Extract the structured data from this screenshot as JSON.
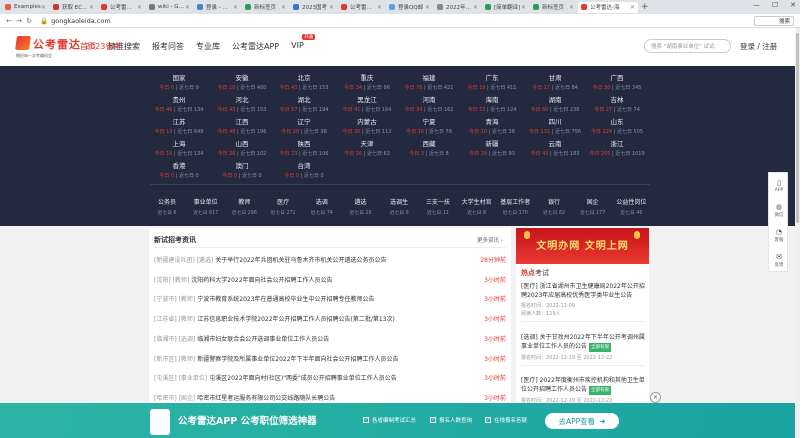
{
  "tabs": [
    {
      "label": "Examples",
      "color": "#e35b4f"
    },
    {
      "label": "获取 EChar",
      "color": "#cc3333"
    },
    {
      "label": "公考雷达-海",
      "color": "#e23a30"
    },
    {
      "label": "wiki - Goo",
      "color": "#777777"
    },
    {
      "label": "登录 - 素材",
      "color": "#3a87c8"
    },
    {
      "label": "新标签页",
      "color": "#2d9a5c"
    },
    {
      "label": "2023国考",
      "color": "#2d78d6"
    },
    {
      "label": "公考雷达-海",
      "color": "#e23a30"
    },
    {
      "label": "登录QQ邮",
      "color": "#5aa0e6"
    },
    {
      "label": "2022年事业",
      "color": "#888888"
    },
    {
      "label": "[简单翻译]",
      "color": "#2d9a5c"
    },
    {
      "label": "新标签页",
      "color": "#2d9a5c"
    },
    {
      "label": "公考雷达-海",
      "color": "#e23a30",
      "active": true
    }
  ],
  "window_controls": [
    "—",
    "☐",
    "✕"
  ],
  "address": {
    "url": "gongkaoleida.com",
    "search": "搜索"
  },
  "header": {
    "logo_name": "公考雷达",
    "logo_slogan": "捕捉每一次考编机会",
    "nav": [
      {
        "label": "首页",
        "state": "cur"
      },
      {
        "label": "精准搜索"
      },
      {
        "label": "报考问答"
      },
      {
        "label": "2023省考",
        "state": "hot"
      },
      {
        "label": "专业库"
      },
      {
        "label": "公考雷达APP"
      },
      {
        "label": "VIP",
        "badge": "开通"
      }
    ],
    "search_placeholder": "搜索 \"湖南事业单位\" 试试",
    "login": "登录 / 注册"
  },
  "provinces": [
    {
      "name": "国家",
      "today": "今日 0",
      "week": "近七日 9"
    },
    {
      "name": "安徽",
      "today": "今日 10",
      "week": "近七日 460"
    },
    {
      "name": "北京",
      "today": "今日 43",
      "week": "近七日 153"
    },
    {
      "name": "重庆",
      "today": "今日 34",
      "week": "近七日 96"
    },
    {
      "name": "福建",
      "today": "今日 76",
      "week": "近七日 421"
    },
    {
      "name": "广东",
      "today": "今日 19",
      "week": "近七日 411"
    },
    {
      "name": "甘肃",
      "today": "今日 17",
      "week": "近七日 84"
    },
    {
      "name": "广西",
      "today": "今日 50",
      "week": "近七日 345"
    },
    {
      "name": "贵州",
      "today": "今日 46",
      "week": "近七日 134"
    },
    {
      "name": "河北",
      "today": "今日 43",
      "week": "近七日 153"
    },
    {
      "name": "湖北",
      "today": "今日 57",
      "week": "近七日 194"
    },
    {
      "name": "黑龙江",
      "today": "今日 41",
      "week": "近七日 164"
    },
    {
      "name": "河南",
      "today": "今日 34",
      "week": "近七日 162"
    },
    {
      "name": "海南",
      "today": "今日 23",
      "week": "近七日 124"
    },
    {
      "name": "湖南",
      "today": "今日 60",
      "week": "近七日 238"
    },
    {
      "name": "吉林",
      "today": "今日 27",
      "week": "近七日 74"
    },
    {
      "name": "江苏",
      "today": "今日 13",
      "week": "近七日 649"
    },
    {
      "name": "江西",
      "today": "今日 48",
      "week": "近七日 196"
    },
    {
      "name": "辽宁",
      "today": "今日 20",
      "week": "近七日 98"
    },
    {
      "name": "内蒙古",
      "today": "今日 35",
      "week": "近七日 112"
    },
    {
      "name": "宁夏",
      "today": "今日 16",
      "week": "近七日 78"
    },
    {
      "name": "青海",
      "today": "今日 10",
      "week": "近七日 38"
    },
    {
      "name": "四川",
      "today": "今日 131",
      "week": "近七日 756"
    },
    {
      "name": "山东",
      "today": "今日 124",
      "week": "近七日 505"
    },
    {
      "name": "上海",
      "today": "今日 16",
      "week": "近七日 134"
    },
    {
      "name": "山西",
      "today": "今日 26",
      "week": "近七日 102"
    },
    {
      "name": "陕西",
      "today": "今日 23",
      "week": "近七日 106"
    },
    {
      "name": "天津",
      "today": "今日 16",
      "week": "近七日 63"
    },
    {
      "name": "西藏",
      "today": "今日 3",
      "week": "近七日 8"
    },
    {
      "name": "新疆",
      "today": "今日 29",
      "week": "近七日 93"
    },
    {
      "name": "云南",
      "today": "今日 43",
      "week": "近七日 183"
    },
    {
      "name": "浙江",
      "today": "今日 205",
      "week": "近七日 1019"
    },
    {
      "name": "香港",
      "today": "今日 0",
      "week": "近七日 0"
    },
    {
      "name": "澳门",
      "today": "今日 0",
      "week": "近七日 0"
    },
    {
      "name": "台湾",
      "today": "今日 0",
      "week": "近七日 0"
    }
  ],
  "categories": [
    {
      "name": "公务员",
      "count": "近七日 6"
    },
    {
      "name": "事业单位",
      "count": "近七日 617"
    },
    {
      "name": "教师",
      "count": "近七日 296"
    },
    {
      "name": "医疗",
      "count": "近七日 272"
    },
    {
      "name": "选调",
      "count": "近七日 74"
    },
    {
      "name": "遴选",
      "count": "近七日 26"
    },
    {
      "name": "选调生",
      "count": "近七日 9"
    },
    {
      "name": "三支一扶",
      "count": "近七日 11"
    },
    {
      "name": "大学生村官",
      "count": "近七日 8"
    },
    {
      "name": "基层工作者",
      "count": "近七日 170"
    },
    {
      "name": "银行",
      "count": "近七日 82"
    },
    {
      "name": "国企",
      "count": "近七日 177"
    },
    {
      "name": "公益性岗位",
      "count": "近七日 46"
    }
  ],
  "news": {
    "title": "新试招考资讯",
    "more": "更多资讯 ›",
    "items": [
      {
        "tag": "[新疆建设兵团] [遴选]",
        "title": "关于举行2022年兵团机关驻乌鲁木齐市机关公开遴选公务员公告",
        "time": "28分钟前"
      },
      {
        "tag": "[沈阳] [教师]",
        "title": "沈阳药科大学2022年面向社会公开招聘工作人员公告",
        "time": "3小时前"
      },
      {
        "tag": "[宁波市] [教师]",
        "title": "宁波市教育系统2023年在普通高校毕业生中公开招聘专任教师公告",
        "time": "3小时前"
      },
      {
        "tag": "[江苏省] [教师]",
        "title": "江苏信息职业技术学院2022年公开招聘工作人员招聘公告(第二批/第13次)",
        "time": "3小时前"
      },
      {
        "tag": "[临湘市] [选调]",
        "title": "临湘市妇女联合会公开选调事业单位工作人员公告",
        "time": "3小时前"
      },
      {
        "tag": "[新市区] [教师]",
        "title": "新疆警察学院及所属事业单位2022年下半年面向社会公开招聘工作人员公告",
        "time": "3小时前"
      },
      {
        "tag": "[屯溪区] [事业单位]",
        "title": "屯溪区2022年面向村(社区)\"两委\"成员公开招聘事业单位工作人员公告",
        "time": "3小时前"
      },
      {
        "tag": "[哈密市] [国企]",
        "title": "哈密市红星者运服务有限公司公交线路随队长聘公告",
        "time": "3小时前"
      }
    ]
  },
  "sidebar": {
    "banner": "文明办网  文明上网",
    "hot_title_a": "热点",
    "hot_title_b": "考试",
    "items": [
      {
        "title": "[医疗] 浙江省湖州市卫生健康局2022年公开招聘2023年应届高校优秀医学类毕业生公告",
        "status": "",
        "deadline": "报名时间：2022-12-09",
        "views": "阅读人数：129人"
      },
      {
        "title": "[选调] 关于甘孜州2022年下半年公开考调州属事业单位工作人员的公告",
        "status": "全部有限",
        "deadline": "报名时间：2022-12-19 至 2022-12-22",
        "views": ""
      },
      {
        "title": "[医疗] 2022年度衡州市疾控机构和其他卫生单位公开招聘工作人员公告",
        "status": "全部有限",
        "deadline": "报名时间：2022-12-19 至 2022-12-22",
        "views": ""
      }
    ]
  },
  "floating_bar": [
    {
      "icon": "phone-icon",
      "glyph": "▯",
      "label": "APP"
    },
    {
      "icon": "wechat-icon",
      "glyph": "◍",
      "label": "微信"
    },
    {
      "icon": "headset-icon",
      "glyph": "◔",
      "label": "客服"
    },
    {
      "icon": "feedback-icon",
      "glyph": "✉",
      "label": "反馈"
    }
  ],
  "bottom_bar": {
    "title": "公考雷达APP  公考职位筛选神器",
    "checks": [
      "各省编制考试汇总",
      "报名人数查询",
      "在线报名答疑"
    ],
    "button": "去APP查看",
    "close": "✕"
  }
}
